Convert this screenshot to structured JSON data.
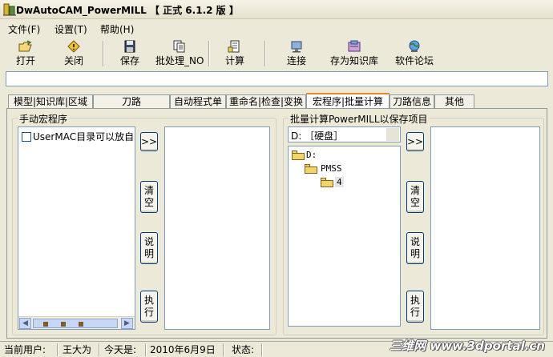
{
  "window": {
    "title": "DwAutoCAM_PowerMILL 【 正式 6.1.2 版 】"
  },
  "menu": [
    {
      "label": "文件(F)"
    },
    {
      "label": "设置(T)"
    },
    {
      "label": "帮助(H)"
    }
  ],
  "toolbar": {
    "open": "打开",
    "close": "关闭",
    "save": "保存",
    "batch": "批处理_NO",
    "calc": "计算",
    "connect": "连接",
    "save_kb": "存为知识库",
    "forum": "软件论坛"
  },
  "path_field": {
    "value": ""
  },
  "tabs": [
    {
      "label": "模型|知识库|区域"
    },
    {
      "label": "刀路"
    },
    {
      "label": "自动程式单"
    },
    {
      "label": "重命名|检查|变换"
    },
    {
      "label": "宏程序|批量计算"
    },
    {
      "label": "刀路信息"
    },
    {
      "label": "其他"
    }
  ],
  "left_group": {
    "legend": "手动宏程序",
    "list_item": "UserMAC目录可以放自己",
    "btn_add": ">>",
    "btn_clear": "清空",
    "btn_help": "说明",
    "btn_run": "执行"
  },
  "right_group": {
    "legend": "批量计算PowerMILL以保存项目",
    "drive": "D: ［硬盘］",
    "tree": [
      {
        "label": "D:"
      },
      {
        "label": "PMSS"
      },
      {
        "label": "4"
      }
    ],
    "btn_add": ">>",
    "btn_clear": "清空",
    "btn_help": "说明",
    "btn_run": "执行"
  },
  "status": {
    "user_label": "当前用户:",
    "user": "王大为",
    "today_label": "今天是:",
    "date": "2010年6月9日",
    "state_label": "状态:",
    "state": ""
  },
  "watermark": "三维网 www.3dportal.cn",
  "colors": {
    "window_bg": "#ece9d8",
    "active_tab_accent": "#e68b2c",
    "field_border": "#7f9db9"
  }
}
